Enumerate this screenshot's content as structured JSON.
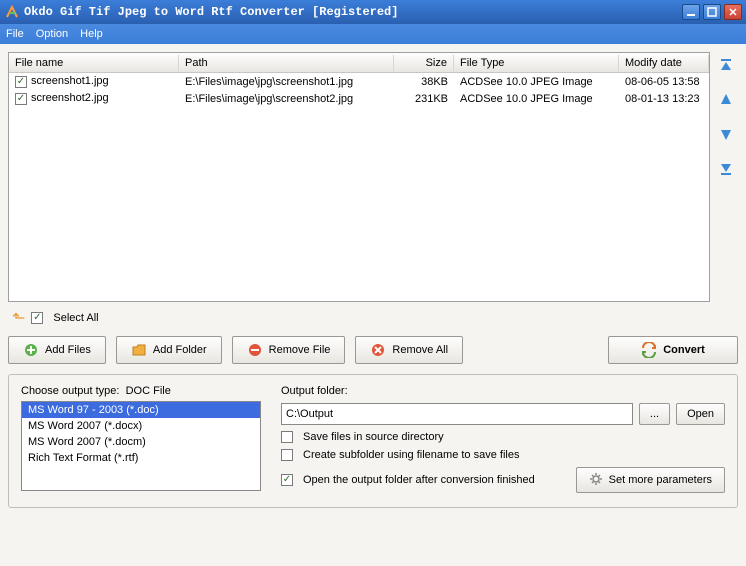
{
  "window": {
    "title": "Okdo Gif Tif Jpeg to Word Rtf Converter [Registered]"
  },
  "menu": {
    "file": "File",
    "option": "Option",
    "help": "Help"
  },
  "columns": {
    "name": "File name",
    "path": "Path",
    "size": "Size",
    "type": "File Type",
    "date": "Modify date"
  },
  "rows": [
    {
      "checked": true,
      "name": "screenshot1.jpg",
      "path": "E:\\Files\\image\\jpg\\screenshot1.jpg",
      "size": "38KB",
      "type": "ACDSee 10.0 JPEG Image",
      "date": "08-06-05 13:58"
    },
    {
      "checked": true,
      "name": "screenshot2.jpg",
      "path": "E:\\Files\\image\\jpg\\screenshot2.jpg",
      "size": "231KB",
      "type": "ACDSee 10.0 JPEG Image",
      "date": "08-01-13 13:23"
    }
  ],
  "selectAll": {
    "label": "Select All",
    "checked": true
  },
  "buttons": {
    "addFiles": "Add Files",
    "addFolder": "Add Folder",
    "removeFile": "Remove File",
    "removeAll": "Remove All",
    "convert": "Convert"
  },
  "outputType": {
    "label": "Choose output type:",
    "current": "DOC File",
    "items": [
      "MS Word 97 - 2003 (*.doc)",
      "MS Word 2007 (*.docx)",
      "MS Word 2007 (*.docm)",
      "Rich Text Format (*.rtf)"
    ],
    "selectedIndex": 0
  },
  "outputFolder": {
    "label": "Output folder:",
    "value": "C:\\Output",
    "browse": "...",
    "open": "Open"
  },
  "options": {
    "saveSource": {
      "label": "Save files in source directory",
      "checked": false
    },
    "subfolder": {
      "label": "Create subfolder using filename to save files",
      "checked": false
    },
    "openAfter": {
      "label": "Open the output folder after conversion finished",
      "checked": true
    }
  },
  "moreParams": "Set more parameters"
}
